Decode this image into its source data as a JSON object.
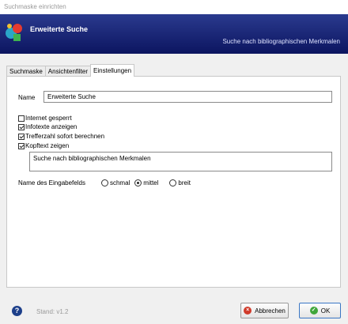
{
  "window": {
    "title": "Suchmaske einrichten"
  },
  "banner": {
    "title": "Erweiterte Suche",
    "subtitle": "Suche nach bibliographischen Merkmalen"
  },
  "tabs": [
    {
      "label": "Suchmaske",
      "active": false
    },
    {
      "label": "Ansichtenfilter",
      "active": false
    },
    {
      "label": "Einstellungen",
      "active": true
    }
  ],
  "form": {
    "name_label": "Name",
    "name_value": "Erweiterte Suche",
    "checkboxes": [
      {
        "label": "Internet gesperrt",
        "checked": false
      },
      {
        "label": "Infotexte anzeigen",
        "checked": true
      },
      {
        "label": "Trefferzahl sofort berechnen",
        "checked": true
      },
      {
        "label": "Kopftext zeigen",
        "checked": true
      }
    ],
    "kopftext": "Suche nach bibliographischen Merkmalen",
    "size_label": "Name des Eingabefelds",
    "size_options": [
      {
        "label": "schmal",
        "selected": false
      },
      {
        "label": "mittel",
        "selected": true
      },
      {
        "label": "breit",
        "selected": false
      }
    ]
  },
  "footer": {
    "version": "Stand: v1.2",
    "cancel_label": "Abbrechen",
    "ok_label": "OK"
  }
}
